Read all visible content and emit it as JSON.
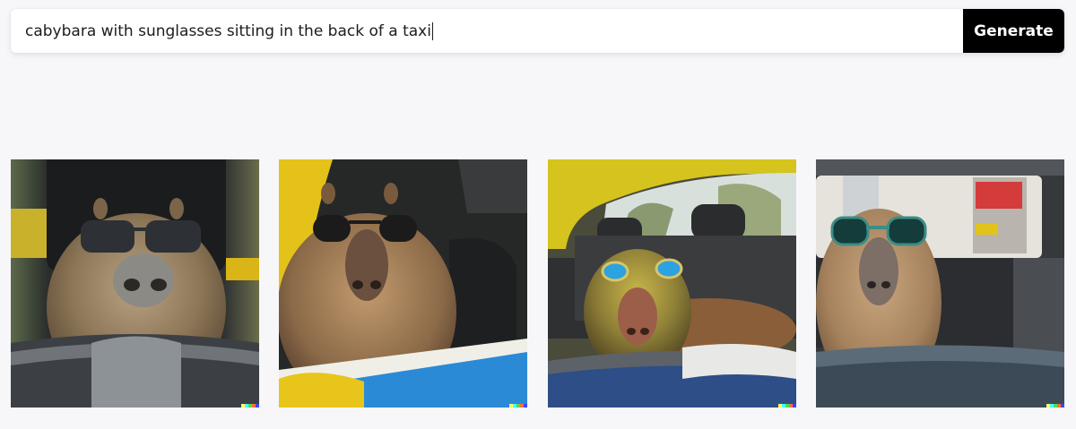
{
  "prompt": {
    "value": "cabybara with sunglasses sitting in the back of a taxi",
    "generate_label": "Generate"
  },
  "results": {
    "images": [
      {
        "name": "capybara-image-1",
        "subject": "capybara wearing dark sunglasses, headrest behind, car interior"
      },
      {
        "name": "capybara-image-2",
        "subject": "capybara wearing round black sunglasses in yellow taxi"
      },
      {
        "name": "capybara-image-3",
        "subject": "capybara wearing blue goggles in yellow car"
      },
      {
        "name": "capybara-image-4",
        "subject": "capybara wearing teal sunglasses in car back seat"
      }
    ],
    "signature_colors": [
      "#ffff66",
      "#42ffff",
      "#51da4c",
      "#ff6e3c",
      "#3c46ff"
    ]
  }
}
